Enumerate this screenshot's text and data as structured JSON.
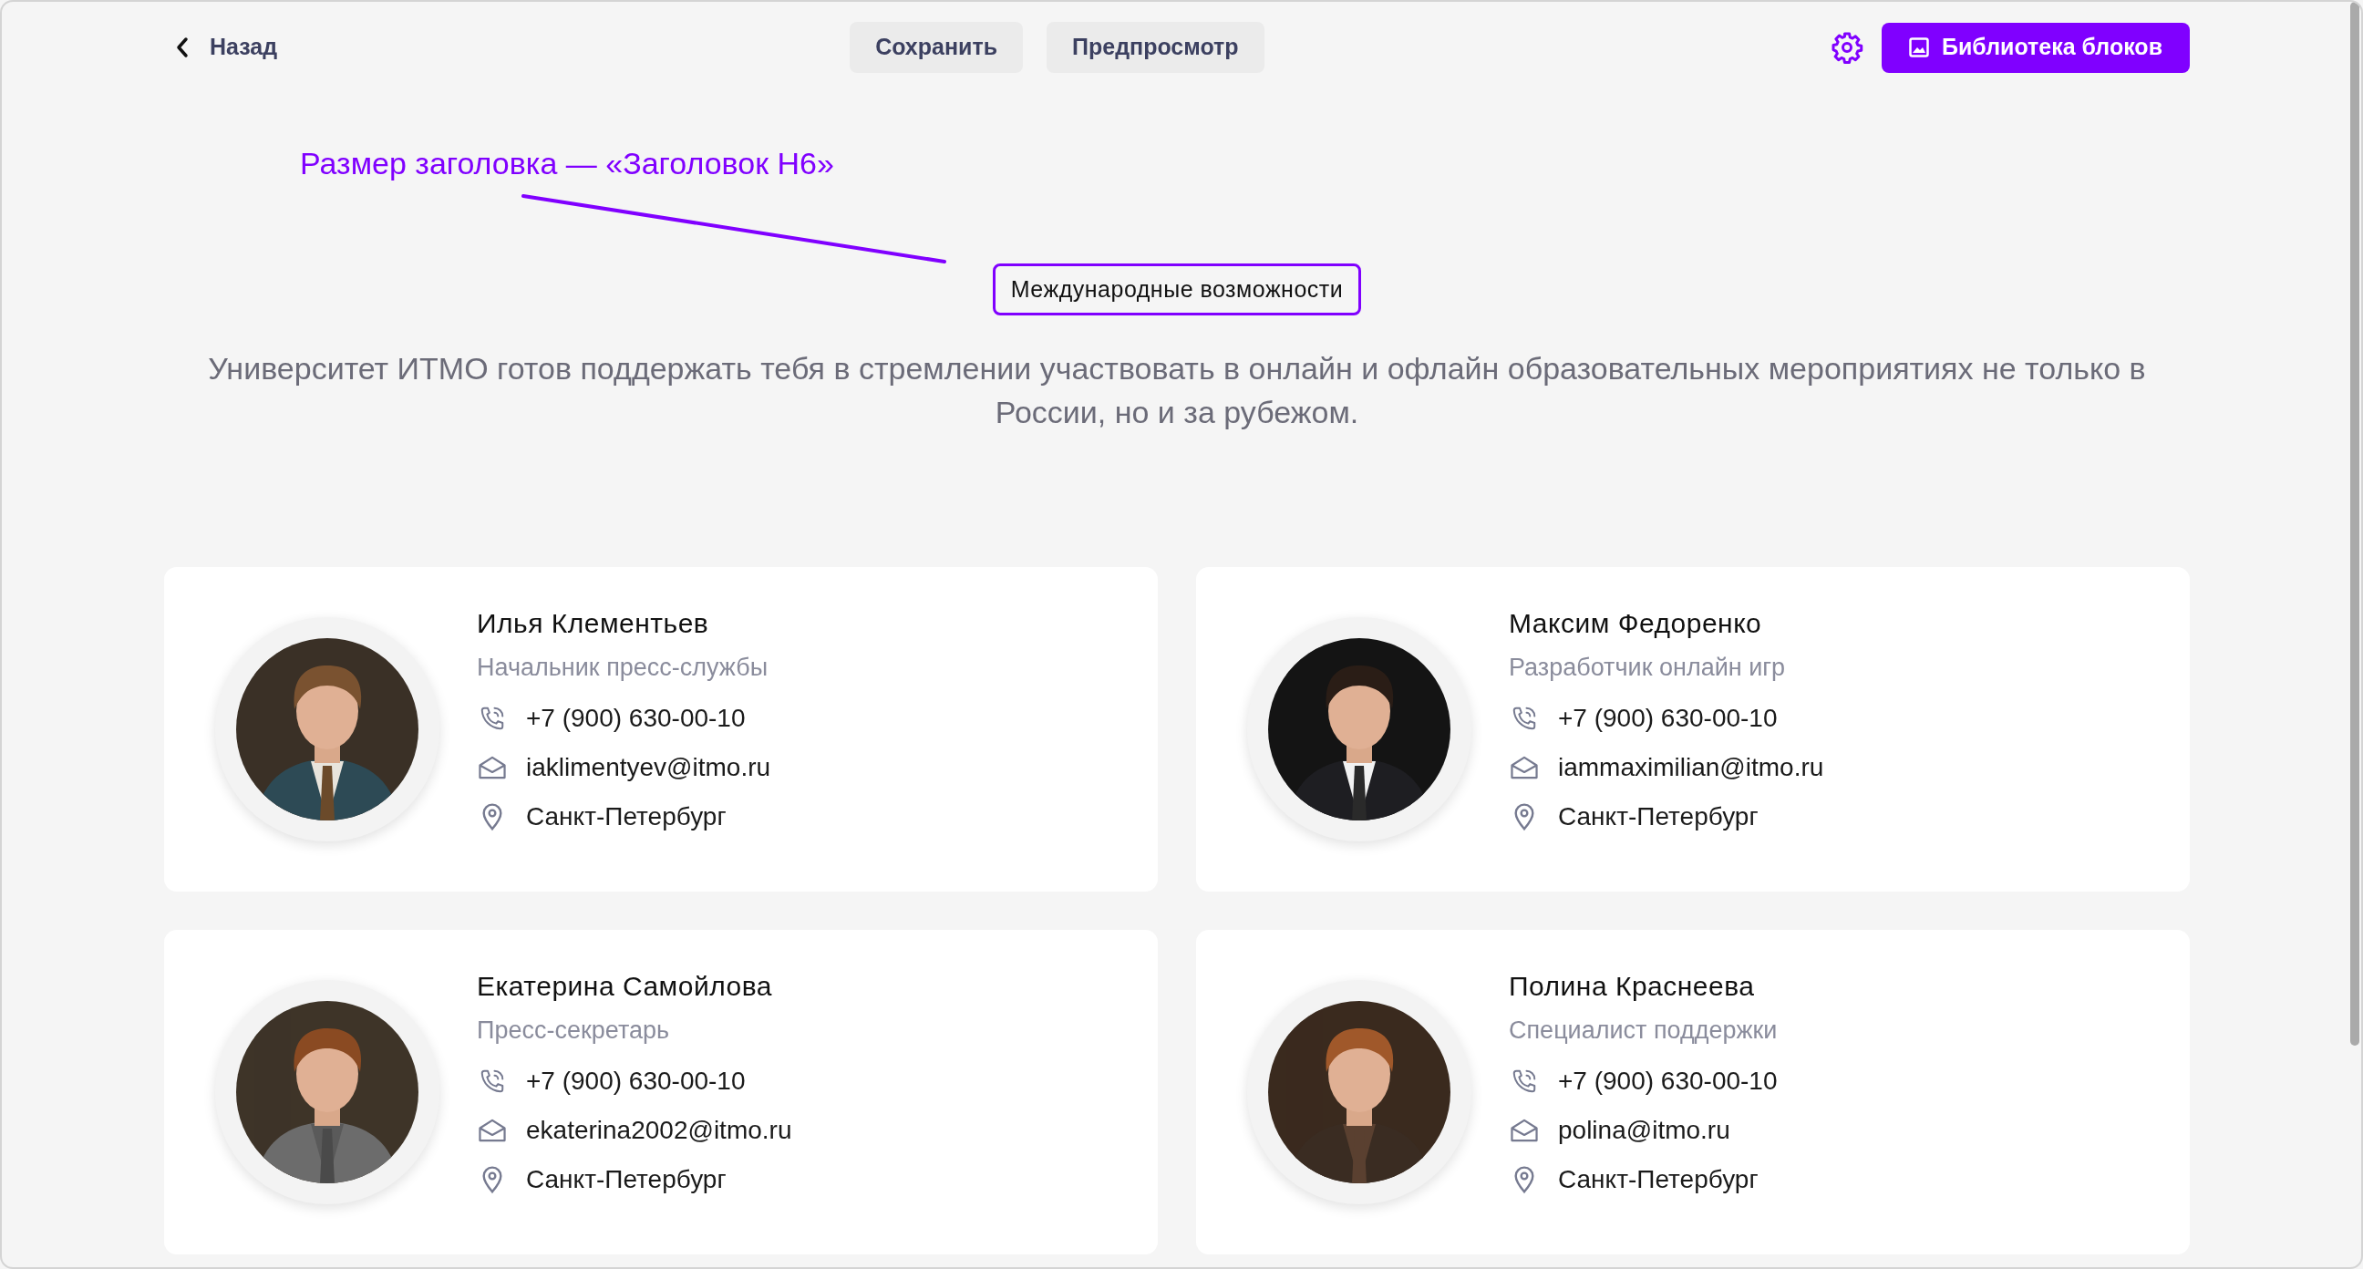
{
  "topbar": {
    "back_link": "Назад",
    "buttons": [
      {
        "label": "Сохранить"
      },
      {
        "label": "Предпросмотр"
      }
    ],
    "library_button": "Библиотека блоков"
  },
  "annotation": "Размер заголовка — «Заголовок H6»",
  "heading": "Международные возможности",
  "description": "Университет ИТМО готов поддержать тебя в стремлении участвовать в онлайн и офлайн образовательных мероприятиях не только в России, но и за рубежом.",
  "contacts": [
    {
      "name": "Илья Клементьев",
      "role": "Начальник пресс-службы",
      "phone": "+7 (900) 630-00-10",
      "email": "iaklimentyev@itmo.ru",
      "city": "Санкт-Петербург"
    },
    {
      "name": "Максим Федоренко",
      "role": "Разработчик онлайн игр",
      "phone": "+7 (900) 630-00-10",
      "email": "iammaximilian@itmo.ru",
      "city": "Санкт-Петербург"
    },
    {
      "name": "Екатерина Самойлова",
      "role": "Пресс-секретарь",
      "phone": "+7 (900) 630-00-10",
      "email": "ekaterina2002@itmo.ru",
      "city": "Санкт-Петербург"
    },
    {
      "name": "Полина Краснеева",
      "role": "Специалист поддержки",
      "phone": "+7 (900) 630-00-10",
      "email": "polina@itmo.ru",
      "city": "Санкт-Петербург"
    }
  ]
}
